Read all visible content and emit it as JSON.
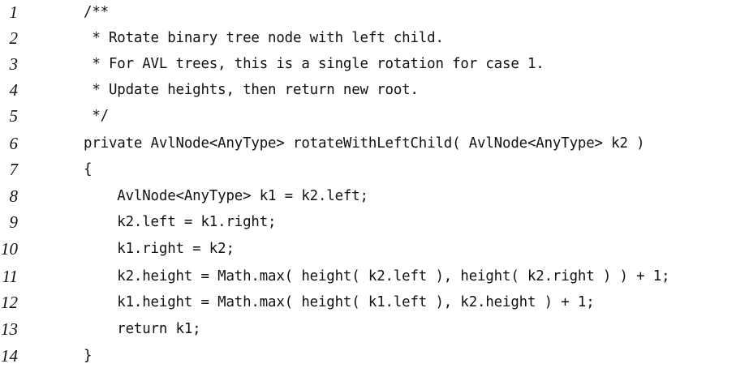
{
  "code_listing": {
    "lines": [
      {
        "number": "1",
        "text": "/**"
      },
      {
        "number": "2",
        "text": " * Rotate binary tree node with left child."
      },
      {
        "number": "3",
        "text": " * For AVL trees, this is a single rotation for case 1."
      },
      {
        "number": "4",
        "text": " * Update heights, then return new root."
      },
      {
        "number": "5",
        "text": " */"
      },
      {
        "number": "6",
        "text": "private AvlNode<AnyType> rotateWithLeftChild( AvlNode<AnyType> k2 )"
      },
      {
        "number": "7",
        "text": "{"
      },
      {
        "number": "8",
        "text": "    AvlNode<AnyType> k1 = k2.left;"
      },
      {
        "number": "9",
        "text": "    k2.left = k1.right;"
      },
      {
        "number": "10",
        "text": "    k1.right = k2;"
      },
      {
        "number": "11",
        "text": "    k2.height = Math.max( height( k2.left ), height( k2.right ) ) + 1;"
      },
      {
        "number": "12",
        "text": "    k1.height = Math.max( height( k1.left ), k2.height ) + 1;"
      },
      {
        "number": "13",
        "text": "    return k1;"
      },
      {
        "number": "14",
        "text": "}"
      }
    ]
  }
}
